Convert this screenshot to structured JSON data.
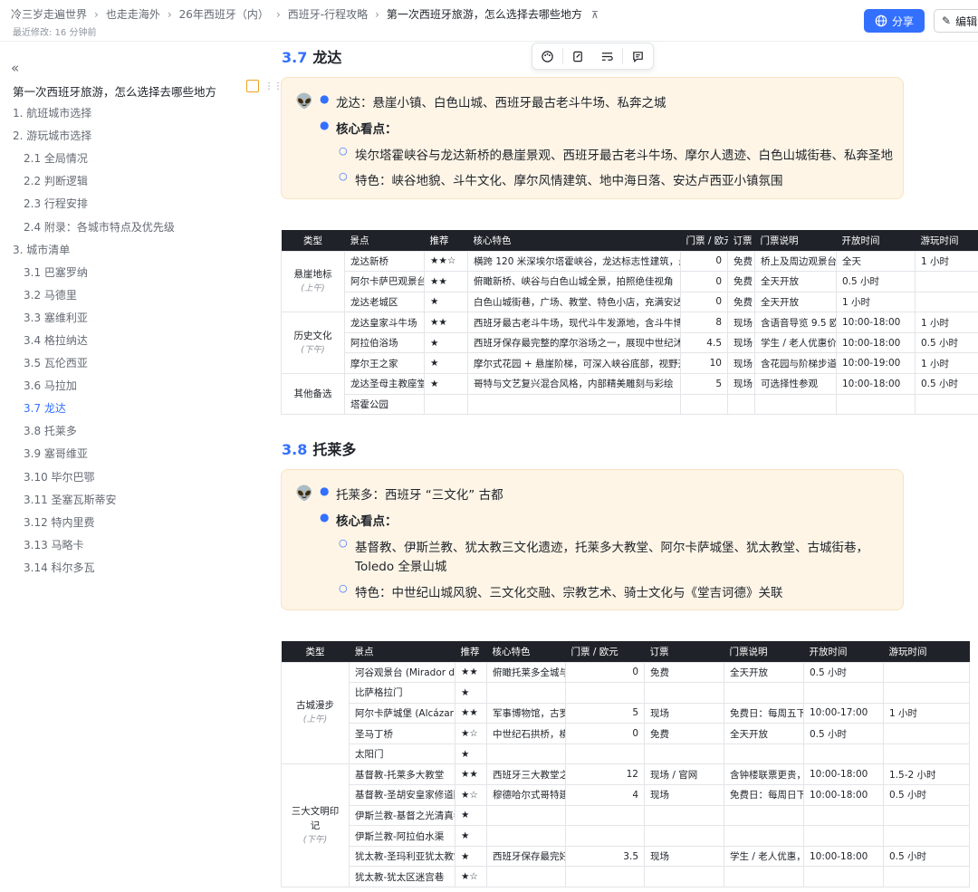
{
  "breadcrumb": [
    "冷三岁走遍世界",
    "也走走海外",
    "26年西班牙（内）",
    "西班牙-行程攻略",
    "第一次西班牙旅游，怎么选择去哪些地方"
  ],
  "last_modified": "最近修改: 16 分钟前",
  "share_label": "分享",
  "edit_label": "编辑",
  "sidebar": {
    "title": "第一次西班牙旅游，怎么选择去哪些地方",
    "toc": [
      {
        "label": "1. 航班城市选择",
        "level": 1
      },
      {
        "label": "2. 游玩城市选择",
        "level": 1
      },
      {
        "label": "2.1 全局情况",
        "level": 2
      },
      {
        "label": "2.2 判断逻辑",
        "level": 2
      },
      {
        "label": "2.3 行程安排",
        "level": 2
      },
      {
        "label": "2.4 附录：各城市特点及优先级",
        "level": 2
      },
      {
        "label": "3. 城市清单",
        "level": 1
      },
      {
        "label": "3.1 巴塞罗纳",
        "level": 2
      },
      {
        "label": "3.2 马德里",
        "level": 2
      },
      {
        "label": "3.3 塞维利亚",
        "level": 2
      },
      {
        "label": "3.4 格拉纳达",
        "level": 2
      },
      {
        "label": "3.5 瓦伦西亚",
        "level": 2
      },
      {
        "label": "3.6 马拉加",
        "level": 2
      },
      {
        "label": "3.7 龙达",
        "level": 2,
        "active": true
      },
      {
        "label": "3.8 托莱多",
        "level": 2
      },
      {
        "label": "3.9 塞哥维亚",
        "level": 2
      },
      {
        "label": "3.10 毕尔巴鄂",
        "level": 2
      },
      {
        "label": "3.11 圣塞瓦斯蒂安",
        "level": 2
      },
      {
        "label": "3.12 特内里费",
        "level": 2
      },
      {
        "label": "3.13 马略卡",
        "level": 2
      },
      {
        "label": "3.14 科尔多瓦",
        "level": 2
      }
    ]
  },
  "sections": {
    "s37": {
      "num": "3.7",
      "title": "龙达",
      "callout": {
        "emoji": "👽",
        "line1": "龙达：悬崖小镇、白色山城、西班牙最古老斗牛场、私奔之城",
        "core": "核心看点：",
        "sub1": "埃尔塔霍峡谷与龙达新桥的悬崖景观、西班牙最古老斗牛场、摩尔人遗迹、白色山城街巷、私奔圣地",
        "sub2": "特色：峡谷地貌、斗牛文化、摩尔风情建筑、地中海日落、安达卢西亚小镇氛围"
      },
      "table": {
        "headers": [
          "类型",
          "景点",
          "推荐",
          "核心特色",
          "门票 / 欧元",
          "订票",
          "门票说明",
          "开放时间",
          "游玩时间"
        ],
        "groups": [
          {
            "type": "悬崖地标",
            "sub": "(上午)",
            "rows": [
              [
                "龙达新桥",
                "★★☆",
                "横跨 120 米深埃尔塔霍峡谷，龙达标志性建筑，悬崖",
                "0",
                "免费",
                "桥上及周边观景台均",
                "全天",
                "1 小时"
              ],
              [
                "阿尔卡萨巴观景台",
                "★★",
                "俯瞰新桥、峡谷与白色山城全景，拍照绝佳视角",
                "0",
                "免费",
                "全天开放",
                "0.5 小时",
                ""
              ],
              [
                "龙达老城区",
                "★",
                "白色山城街巷，广场、教堂、特色小店，充满安达卢",
                "0",
                "免费",
                "全天开放",
                "1 小时",
                ""
              ]
            ]
          },
          {
            "type": "历史文化",
            "sub": "(下午)",
            "rows": [
              [
                "龙达皇家斗牛场",
                "★★",
                "西班牙最古老斗牛场，现代斗牛发源地，含斗牛博物",
                "8",
                "现场",
                "含语音导览 9.5 欧元",
                "10:00-18:00",
                "1 小时"
              ],
              [
                "阿拉伯浴场",
                "★",
                "西班牙保存最完整的摩尔浴场之一，展现中世纪沐浴",
                "4.5",
                "现场",
                "学生 / 老人优惠价 3",
                "10:00-18:00",
                "0.5 小时"
              ],
              [
                "摩尔王之家",
                "★",
                "摩尔式花园 + 悬崖阶梯，可深入峡谷底部，视野开阔",
                "10",
                "现场",
                "含花园与阶梯步道",
                "10:00-19:00",
                "1 小时"
              ]
            ]
          },
          {
            "type": "其他备选",
            "sub": "",
            "rows": [
              [
                "龙达圣母主教座堂",
                "★",
                "哥特与文艺复兴混合风格，内部精美雕刻与彩绘",
                "5",
                "现场",
                "可选择性参观",
                "10:00-18:00",
                "0.5 小时"
              ],
              [
                "塔霍公园",
                "",
                "",
                "",
                "",
                "",
                "",
                ""
              ]
            ]
          }
        ]
      }
    },
    "s38": {
      "num": "3.8",
      "title": "托莱多",
      "callout": {
        "emoji": "👽",
        "line1": "托莱多：西班牙 “三文化” 古都",
        "core": "核心看点：",
        "sub1a": "基督教、伊斯兰教、犹太教三文化遗迹，托莱多大教堂、阿尔卡萨城堡、犹太教堂、古城街巷，",
        "sub1b": "Toledo 全景山城",
        "sub2": "特色：中世纪山城风貌、三文化交融、宗教艺术、骑士文化与《堂吉诃德》关联"
      },
      "table": {
        "headers": [
          "类型",
          "景点",
          "推荐",
          "核心特色",
          "门票 / 欧元",
          "订票",
          "门票说明",
          "开放时间",
          "游玩时间"
        ],
        "groups": [
          {
            "type": "古城漫步",
            "sub": "(上午)",
            "rows": [
              [
                "河谷观景台 (Mirador del Valle)",
                "★★",
                "俯瞰托莱多全城与塔",
                "0",
                "免费",
                "全天开放",
                "0.5 小时",
                ""
              ],
              [
                "比萨格拉门",
                "★",
                "",
                "",
                "",
                "",
                "",
                ""
              ],
              [
                "阿尔卡萨城堡 (Alcázar)",
                "★★",
                "军事博物馆，古罗马",
                "5",
                "现场",
                "免费日：每周五下午",
                "10:00-17:00",
                "1 小时"
              ],
              [
                "圣马丁桥",
                "★☆",
                "中世纪石拱桥，横跨",
                "0",
                "免费",
                "全天开放",
                "0.5 小时",
                ""
              ],
              [
                "太阳门",
                "★",
                "",
                "",
                "",
                "",
                "",
                ""
              ]
            ]
          },
          {
            "type": "三大文明印记",
            "sub": "(下午)",
            "rows": [
              [
                "基督教-托莱多大教堂",
                "★★",
                "西班牙三大教堂之一",
                "12",
                "现场 / 官网",
                "含钟楼联票更贵，学",
                "10:00-18:00",
                "1.5-2 小时"
              ],
              [
                "基督教-圣胡安皇家修道院",
                "★☆",
                "穆德哈尔式哥特建筑",
                "4",
                "现场",
                "免费日：每周日下午",
                "10:00-18:00",
                "0.5 小时"
              ],
              [
                "伊斯兰教-基督之光清真寺",
                "★",
                "",
                "",
                "",
                "",
                "",
                ""
              ],
              [
                "伊斯兰教-阿拉伯水渠",
                "★",
                "",
                "",
                "",
                "",
                "",
                ""
              ],
              [
                "犹太教-圣玛利亚犹太教堂",
                "★",
                "西班牙保存最完好的",
                "3.5",
                "现场",
                "学生 / 老人优惠，联",
                "10:00-18:00",
                "0.5 小时"
              ],
              [
                "犹太教-犹太区迷宫巷",
                "★☆",
                "",
                "",
                "",
                "",
                "",
                ""
              ]
            ]
          }
        ]
      }
    }
  }
}
